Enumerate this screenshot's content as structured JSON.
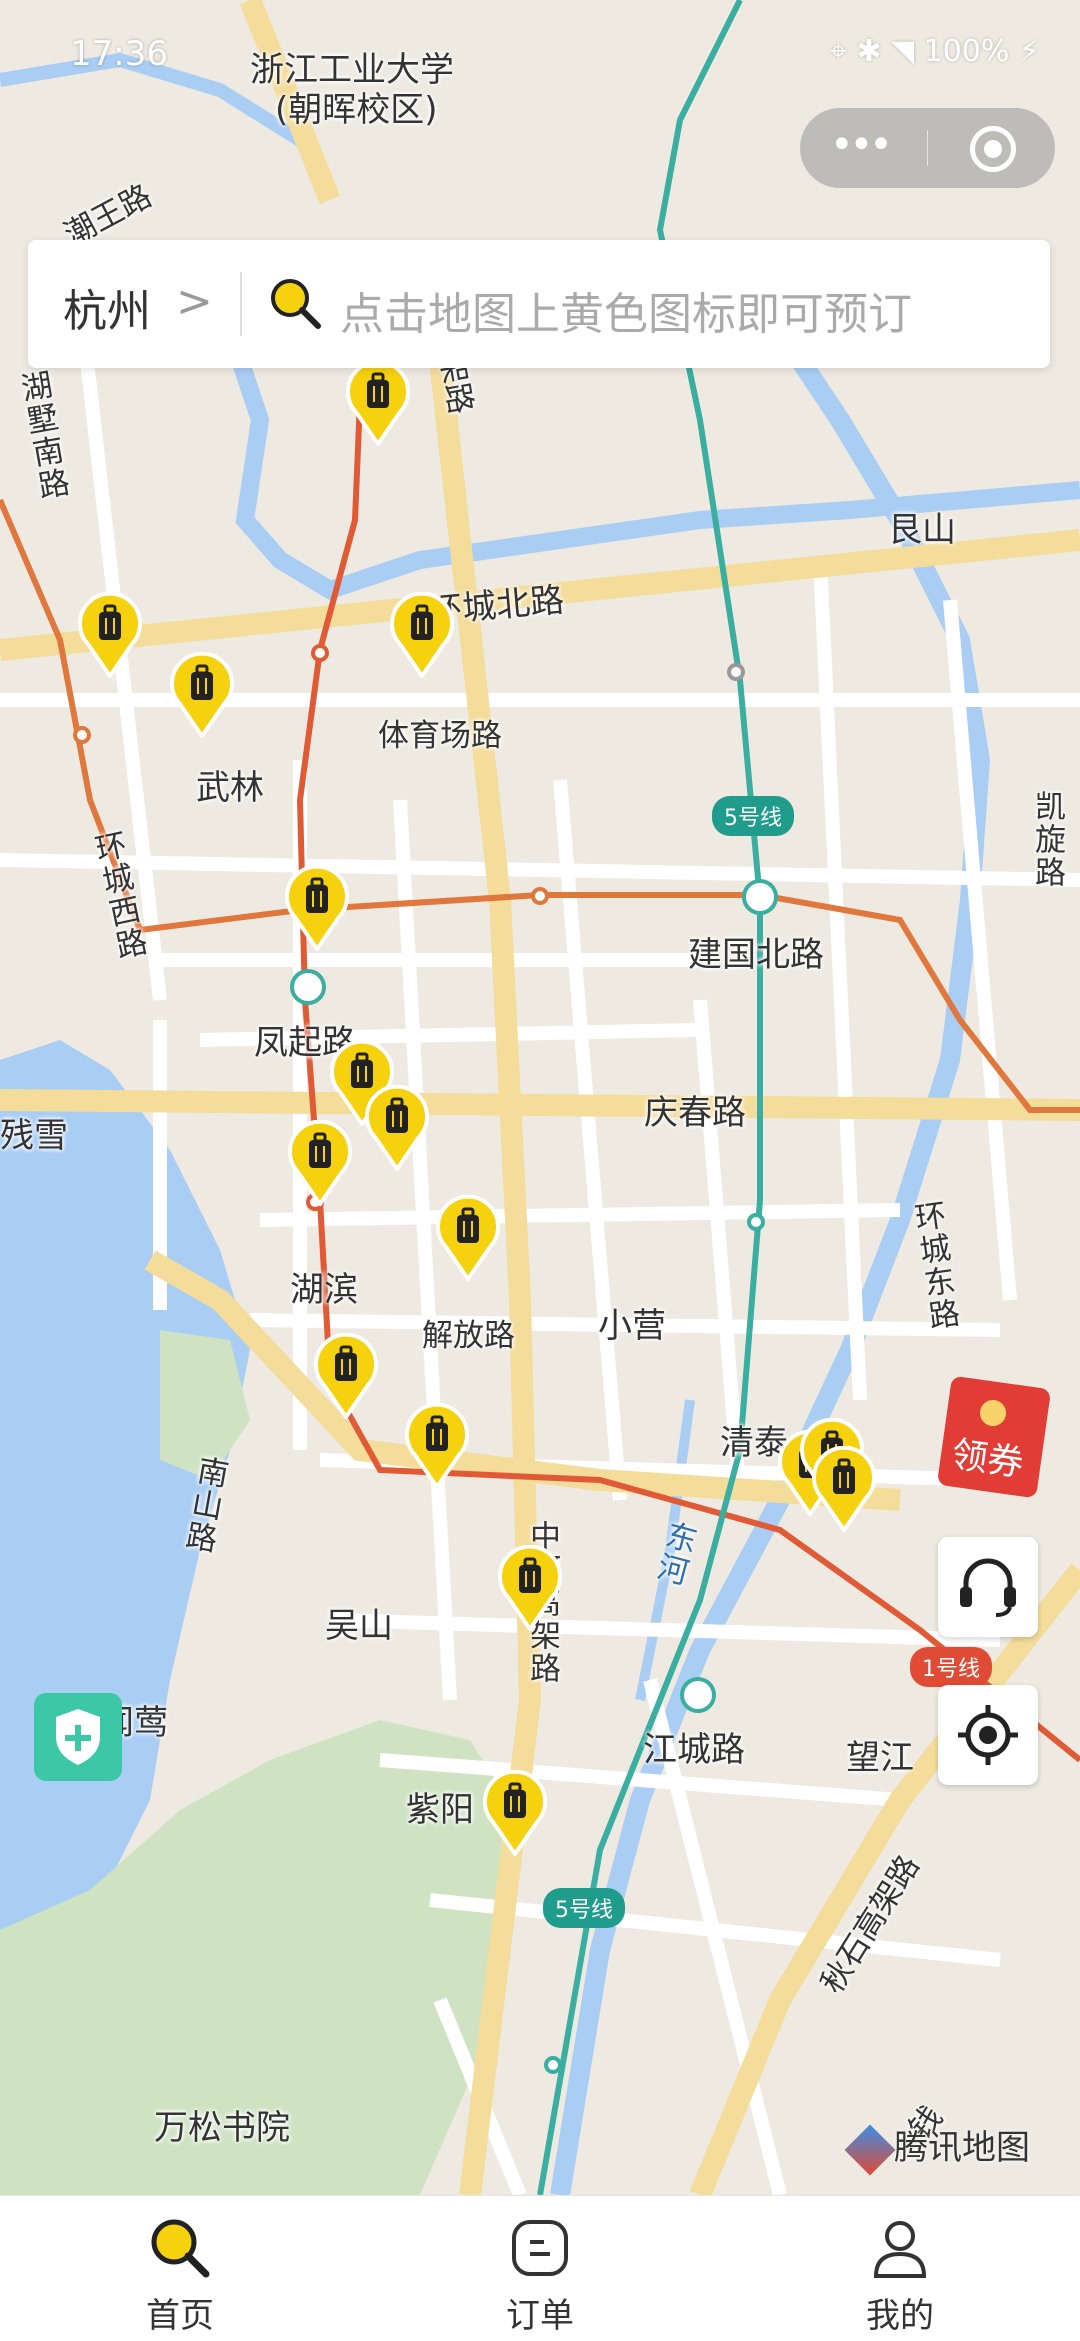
{
  "status_bar": {
    "time": "17:36",
    "right_text": "⌖ ✱ ◥ 100% ⚡"
  },
  "map": {
    "labels": {
      "university": "浙江工业大学",
      "campus": "(朝晖校区)",
      "chaowang_road": "潮王路",
      "hushu_south": "湖墅南路",
      "gen_shan": "艮山",
      "huancheng_north": "环城北路",
      "tiyuchang_road": "体育场路",
      "wulin": "武林",
      "kaixuan_road": "凯旋路",
      "huancheng_west": "环城西路",
      "jianguo_north": "建国北路",
      "fengqi_road": "凤起路",
      "qingchun_road": "庆春路",
      "qianxue": "残雪",
      "huancheng_east": "环城东路",
      "hubin": "湖滨",
      "jiefang_road": "解放路",
      "xiaoying": "小营",
      "qingtai": "清泰",
      "nanshan_road": "南山路",
      "dong_he": "东河",
      "zhonghe_elevated": "中河高架路",
      "wu_shan": "吴山",
      "liulang": "闻莺",
      "jiangcheng_road": "江城路",
      "wang_jiang": "望江",
      "zi_yang": "紫阳",
      "qiushi_elevated": "秋石高架路",
      "wansong": "万松书院",
      "qian": "钱",
      "jia_road": "架路",
      "line5_a": "5号线",
      "line5_b": "5号线",
      "line1": "1号线"
    },
    "pins_icon": "luggage-icon",
    "accent_color": "#f5d10e"
  },
  "header": {
    "capsule_more": "more-icon",
    "capsule_close": "target-icon"
  },
  "search": {
    "city": "杭州",
    "chevron": ">",
    "placeholder": "点击地图上黄色图标即可预订"
  },
  "floating": {
    "coupon_label": "领券",
    "support_icon": "headset-icon",
    "locate_icon": "locate-icon",
    "safety_icon": "shield-plus-icon"
  },
  "watermark": "腾讯地图",
  "tabbar": {
    "tabs": [
      {
        "label": "首页"
      },
      {
        "label": "订单"
      },
      {
        "label": "我的"
      }
    ]
  }
}
